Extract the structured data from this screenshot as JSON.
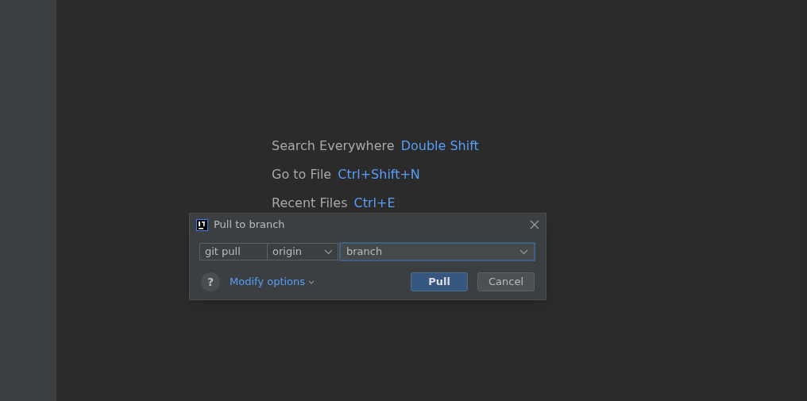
{
  "hints": [
    {
      "label": "Search Everywhere",
      "shortcut": "Double Shift"
    },
    {
      "label": "Go to File",
      "shortcut": "Ctrl+Shift+N"
    },
    {
      "label": "Recent Files",
      "shortcut": "Ctrl+E"
    }
  ],
  "dialog": {
    "title": "Pull to branch",
    "command": "git pull",
    "remote": "origin",
    "branch": "branch",
    "help": "?",
    "modify_options": "Modify options",
    "buttons": [
      {
        "label": "Pull",
        "kind": "primary"
      },
      {
        "label": "Cancel",
        "kind": "secondary"
      }
    ]
  }
}
